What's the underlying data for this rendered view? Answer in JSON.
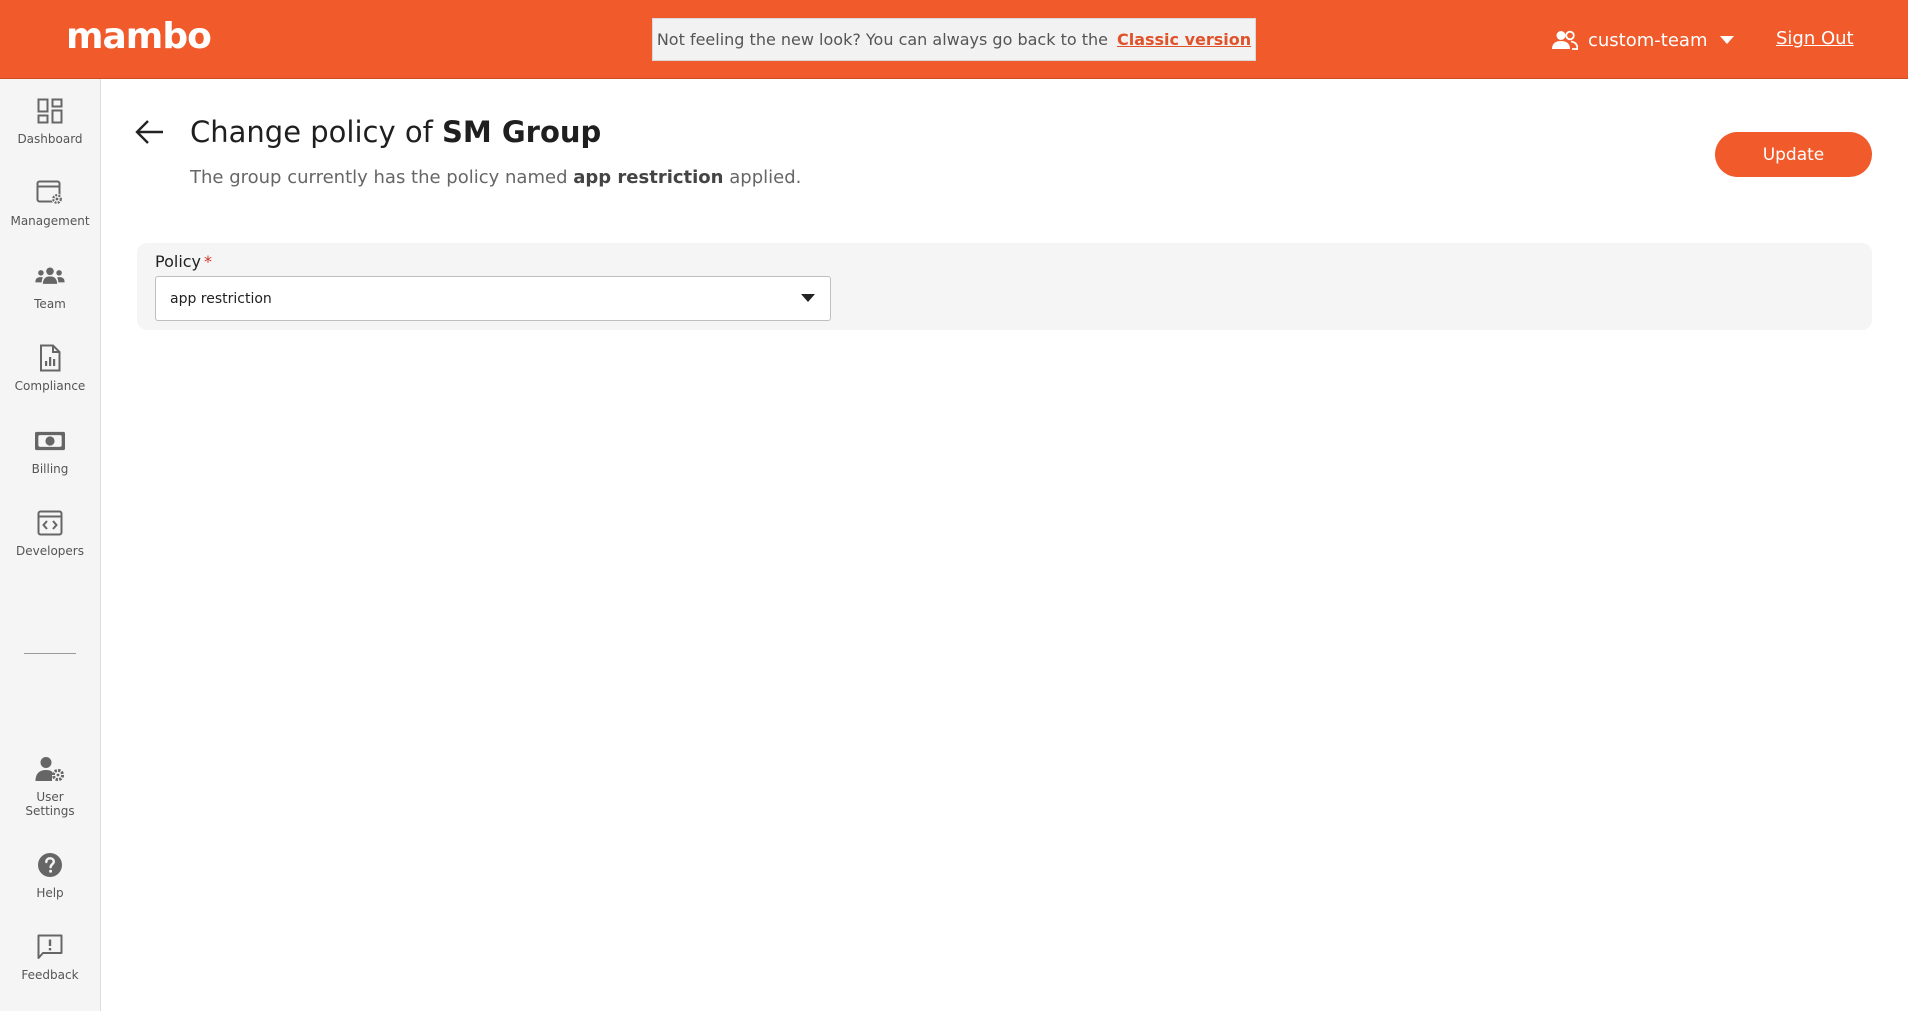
{
  "header": {
    "logo": "mambo",
    "banner_text": "Not feeling the new look? You can always go back to the",
    "banner_link": "Classic version",
    "team_name": "custom-team",
    "team_icon": "people-icon",
    "sign_out": "Sign Out",
    "accent_color": "#f15a2b"
  },
  "sidebar": {
    "items": [
      {
        "label": "Dashboard",
        "icon": "dashboard-icon"
      },
      {
        "label": "Management",
        "icon": "management-icon"
      },
      {
        "label": "Team",
        "icon": "team-icon"
      },
      {
        "label": "Compliance",
        "icon": "compliance-icon"
      },
      {
        "label": "Billing",
        "icon": "billing-icon"
      },
      {
        "label": "Developers",
        "icon": "developers-icon"
      }
    ],
    "bottom_items": [
      {
        "label": "User\nSettings",
        "icon": "user-settings-icon"
      },
      {
        "label": "Help",
        "icon": "help-icon"
      },
      {
        "label": "Feedback",
        "icon": "feedback-icon"
      }
    ]
  },
  "main": {
    "title_prefix": "Change policy of",
    "group_name": "SM Group",
    "subtitle_prefix": "The group currently has the policy named",
    "current_policy": "app restriction",
    "subtitle_suffix": "applied.",
    "update_label": "Update",
    "form": {
      "policy_label": "Policy",
      "required_mark": "*",
      "policy_value": "app restriction"
    }
  }
}
